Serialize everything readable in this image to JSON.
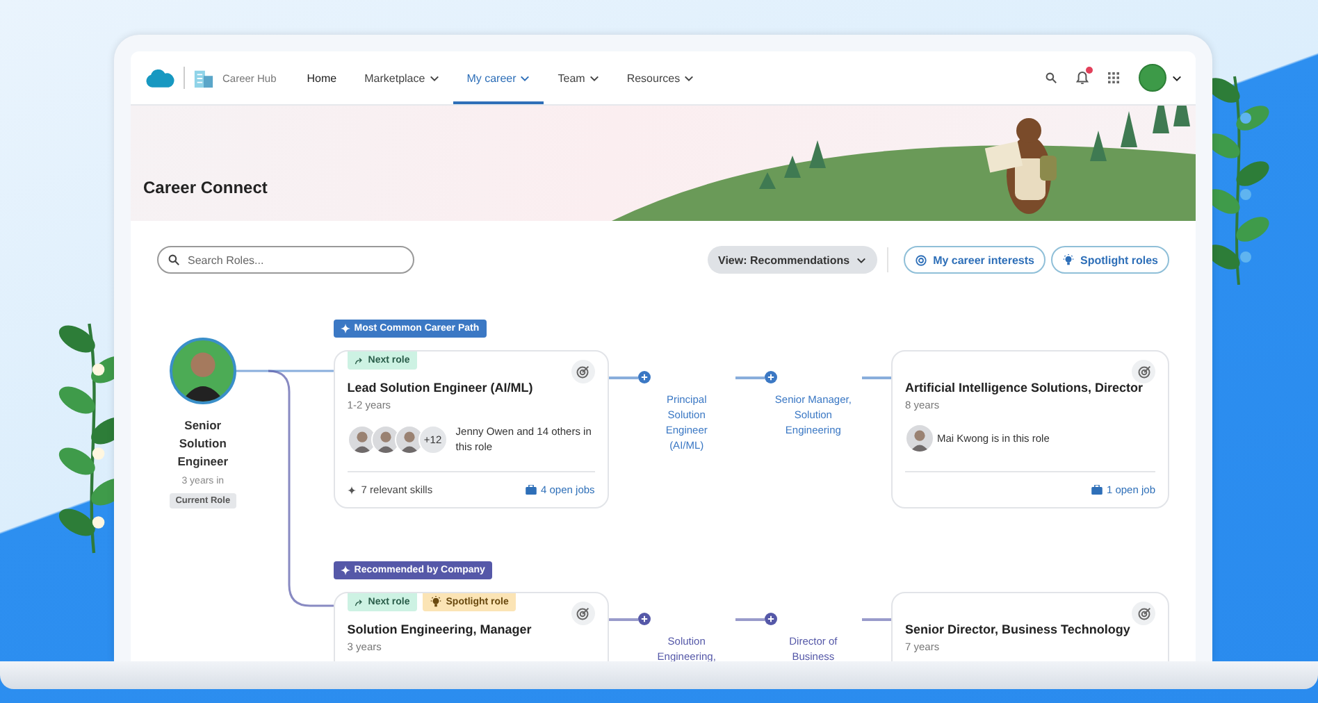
{
  "nav": {
    "app_name": "Career Hub",
    "items": [
      {
        "label": "Home",
        "dropdown": false,
        "selected": false
      },
      {
        "label": "Marketplace",
        "dropdown": true,
        "selected": false
      },
      {
        "label": "My career",
        "dropdown": true,
        "selected": true
      },
      {
        "label": "Team",
        "dropdown": true,
        "selected": false
      },
      {
        "label": "Resources",
        "dropdown": true,
        "selected": false
      }
    ],
    "notifications_unread": true
  },
  "banner": {
    "title": "Career Connect"
  },
  "toolbar": {
    "search": {
      "placeholder": "Search Roles..."
    },
    "view_select": "View: Recommendations",
    "buttons": [
      {
        "label": "My career interests",
        "kind": "interests"
      },
      {
        "label": "Spotlight roles",
        "kind": "spotlight"
      }
    ]
  },
  "current_role": {
    "title": "Senior Solution Engineer",
    "tenure": "3 years in",
    "badge": "Current Role"
  },
  "paths": [
    {
      "label": "Most Common Career Path",
      "color": "#3b78c4",
      "next": {
        "tags": [
          {
            "label": "Next role",
            "kind": "next"
          }
        ],
        "title": "Lead Solution Engineer (AI/ML)",
        "years": "1-2 years",
        "people": {
          "avatars": [
            {
              "kind": "photo"
            },
            {
              "kind": "photo"
            },
            {
              "kind": "photo"
            }
          ],
          "more": "+12",
          "text": "Jenny Owen and 14 others in this role"
        },
        "skills": "7 relevant skills",
        "jobs": "4 open jobs"
      },
      "steps": [
        "Principal Solution Engineer (AI/ML)",
        "Senior Manager, Solution Engineering"
      ],
      "target": {
        "title": "Artificial Intelligence Solutions,  Director",
        "years": "8 years",
        "people": {
          "avatars": [
            {
              "kind": "photo"
            }
          ],
          "text": "Mai Kwong is in this role"
        },
        "jobs": "1 open job"
      }
    },
    {
      "label": "Recommended by Company",
      "color": "#5558a8",
      "next": {
        "tags": [
          {
            "label": "Next role",
            "kind": "next"
          },
          {
            "label": "Spotlight role",
            "kind": "spotlight"
          }
        ],
        "title": "Solution Engineering, Manager",
        "years": "3 years"
      },
      "steps": [
        "Solution Engineering,",
        "Director of Business"
      ],
      "target": {
        "title": "Senior Director, Business Technology",
        "years": "7 years"
      }
    }
  ]
}
